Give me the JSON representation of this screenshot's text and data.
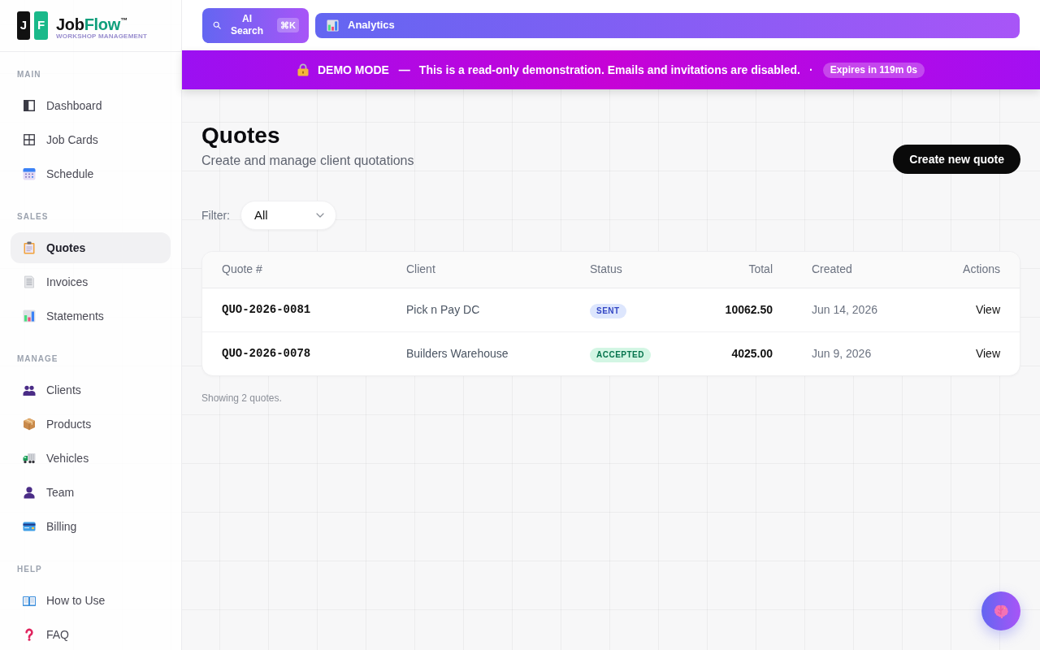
{
  "brand": {
    "tiles": [
      "J",
      "F"
    ],
    "name_dark": "Job",
    "name_accent": "Flow",
    "mark": "™",
    "tagline": "WORKSHOP MANAGEMENT"
  },
  "sidebar": {
    "sections": [
      {
        "title": "MAIN",
        "items": [
          {
            "label": "Dashboard",
            "selected": false
          },
          {
            "label": "Job Cards",
            "selected": false
          },
          {
            "label": "Schedule",
            "selected": false
          }
        ]
      },
      {
        "title": "SALES",
        "items": [
          {
            "label": "Quotes",
            "selected": true
          },
          {
            "label": "Invoices",
            "selected": false
          },
          {
            "label": "Statements",
            "selected": false
          }
        ]
      },
      {
        "title": "MANAGE",
        "items": [
          {
            "label": "Clients",
            "selected": false
          },
          {
            "label": "Products",
            "selected": false
          },
          {
            "label": "Vehicles",
            "selected": false
          },
          {
            "label": "Team",
            "selected": false
          },
          {
            "label": "Billing",
            "selected": false
          }
        ]
      },
      {
        "title": "HELP",
        "items": [
          {
            "label": "How to Use",
            "selected": false
          },
          {
            "label": "FAQ",
            "selected": false
          }
        ]
      }
    ]
  },
  "topbar": {
    "ai_search": {
      "label": "AI Search",
      "shortcut": "⌘K"
    },
    "analytics": {
      "label": "Analytics"
    }
  },
  "demo_banner": {
    "title": "DEMO MODE",
    "dash": "—",
    "message": "This is a read-only demonstration. Emails and invitations are disabled.",
    "separator": "·",
    "expires": "Expires in 119m 0s"
  },
  "page": {
    "title": "Quotes",
    "subtitle": "Create and manage client quotations",
    "create_button": "Create new quote"
  },
  "filter": {
    "label": "Filter:",
    "value": "All"
  },
  "table": {
    "columns": [
      "Quote #",
      "Client",
      "Status",
      "Total",
      "Created",
      "Actions"
    ],
    "rows": [
      {
        "quote_number": "QUO-2026-0081",
        "client": "Pick n Pay DC",
        "status": {
          "label": "SENT",
          "kind": "sent"
        },
        "total": "10062.50",
        "created": "Jun 14, 2026",
        "action": "View"
      },
      {
        "quote_number": "QUO-2026-0078",
        "client": "Builders Warehouse",
        "status": {
          "label": "ACCEPTED",
          "kind": "accepted"
        },
        "total": "4025.00",
        "created": "Jun 9, 2026",
        "action": "View"
      }
    ]
  },
  "footer_note": "Showing 2 quotes."
}
